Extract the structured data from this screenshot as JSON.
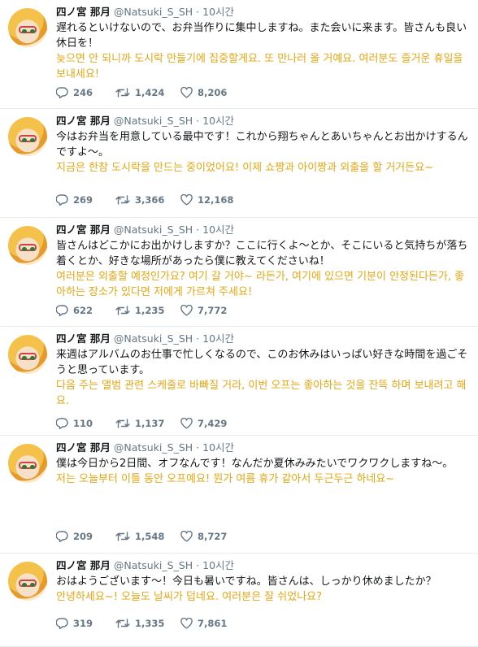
{
  "tweets": [
    {
      "name": "四ノ宮 那月",
      "handle": "@Natsuki_S_SH",
      "sep": "·",
      "time": "10시간",
      "text_ja": "遅れるといけないので、お弁当作りに集中しますね。また会いに来ます。皆さんも良い休日を！",
      "text_ko": "늦으면 안 되니까 도시락 만들기에 집중할게요. 또 만나러 올 거예요. 여러분도 즐거운 휴일을 보내세요!",
      "replies": "246",
      "retweets": "1,424",
      "likes": "8,206"
    },
    {
      "name": "四ノ宮 那月",
      "handle": "@Natsuki_S_SH",
      "sep": "·",
      "time": "10시간",
      "text_ja": "今はお弁当を用意している最中です！これから翔ちゃんとあいちゃんとお出かけするんですよ〜。",
      "text_ko": "지금은 한참 도시락을 만드는 중이었어요! 이제 쇼짱과 아이짱과 외출을 할 거거든요~",
      "replies": "269",
      "retweets": "3,366",
      "likes": "12,168"
    },
    {
      "name": "四ノ宮 那月",
      "handle": "@Natsuki_S_SH",
      "sep": "·",
      "time": "10시간",
      "text_ja": "皆さんはどこかにお出かけしますか？ここに行くよ〜とか、そこにいると気持ちが落ち着くとか、好きな場所があったら僕に教えてくださいね！",
      "text_ko": "여러분은 외출할 예정인가요? 여기 갈 거야~ 라든가, 여기에 있으면 기분이 안정된다든가, 좋아하는 장소가 있다면 저에게 가르쳐 주세요!",
      "replies": "622",
      "retweets": "1,235",
      "likes": "7,772"
    },
    {
      "name": "四ノ宮 那月",
      "handle": "@Natsuki_S_SH",
      "sep": "·",
      "time": "10시간",
      "text_ja": "来週はアルバムのお仕事で忙しくなるので、このお休みはいっぱい好きな時間を過ごそうと思っています。",
      "text_ko": "다음 주는 앨범 관련 스케줄로 바빠질 거라, 이번 오프는 좋아하는 것을 잔뜩 하며 보내려고 해요.",
      "replies": "110",
      "retweets": "1,137",
      "likes": "7,429"
    },
    {
      "name": "四ノ宮 那月",
      "handle": "@Natsuki_S_SH",
      "sep": "·",
      "time": "10시간",
      "text_ja": "僕は今日から2日間、オフなんです！なんだか夏休みみたいでワクワクしますね〜。",
      "text_ko": "저는 오늘부터 이틀 동안 오프예요! 뭔가 여름 휴가 같아서 두근두근 하네요~",
      "replies": "209",
      "retweets": "1,548",
      "likes": "8,727"
    },
    {
      "name": "四ノ宮 那月",
      "handle": "@Natsuki_S_SH",
      "sep": "·",
      "time": "10시간",
      "text_ja": "おはようございます〜！今日も暑いですね。皆さんは、しっかり休めましたか？",
      "text_ko": "안녕하세요~! 오늘도 날씨가 덥네요. 여러분은 잘 쉬었나요?",
      "replies": "319",
      "retweets": "1,335",
      "likes": "7,861"
    }
  ]
}
